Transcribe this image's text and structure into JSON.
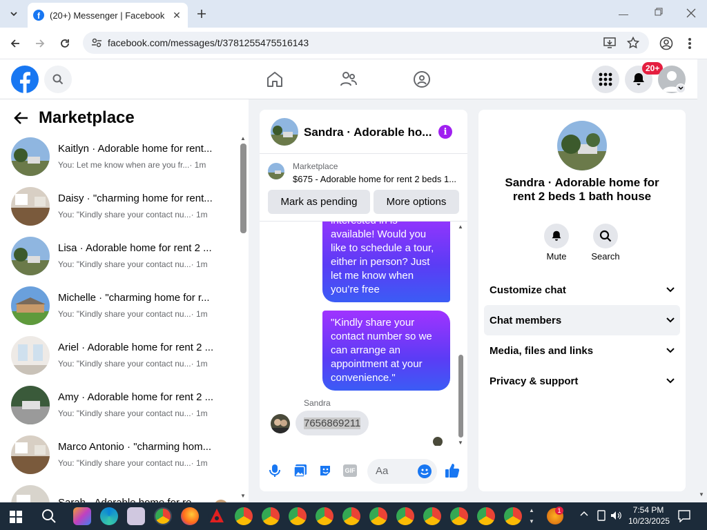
{
  "browser": {
    "tab_title": "(20+) Messenger | Facebook",
    "url": "facebook.com/messages/t/3781255475516143"
  },
  "topbar": {
    "notification_badge": "20+"
  },
  "marketplace": {
    "title": "Marketplace",
    "conversations": [
      {
        "name": "Kaitlyn · Adorable home for rent...",
        "preview": "You: Let me know when are you fr...",
        "time": "· 1m"
      },
      {
        "name": "Daisy · \"charming home for rent...",
        "preview": "You: \"Kindly share your contact nu...",
        "time": "· 1m"
      },
      {
        "name": "Lisa · Adorable home for rent 2 ...",
        "preview": "You: \"Kindly share your contact nu...",
        "time": "· 1m"
      },
      {
        "name": "Michelle · \"charming home for r...",
        "preview": "You: \"Kindly share your contact nu...",
        "time": "· 1m"
      },
      {
        "name": "Ariel · Adorable home for rent 2 ...",
        "preview": "You: \"Kindly share your contact nu...",
        "time": "· 1m"
      },
      {
        "name": "Amy · Adorable home for rent 2 ...",
        "preview": "You: \"Kindly share your contact nu...",
        "time": "· 1m"
      },
      {
        "name": "Marco Antonio · \"charming hom...",
        "preview": "You: \"Kindly share your contact nu...",
        "time": "· 1m"
      },
      {
        "name": "Sarah · Adorable home for re...",
        "preview": "",
        "time": ""
      }
    ]
  },
  "chat": {
    "title": "Sandra · Adorable ho...",
    "listing_label": "Marketplace",
    "listing_desc": "$675 - Adorable home for rent 2 beds 1...",
    "mark_pending": "Mark as pending",
    "more_options": "More options",
    "msg1": "interested in is available! Would you like to schedule a tour, either in person? Just let me know when you’re free",
    "msg2": "\"Kindly share your contact number so we can arrange an appointment at your convenience.\"",
    "sender": "Sandra",
    "reply": "7656869211",
    "input_placeholder": "Aa"
  },
  "info": {
    "name": "Sandra · Adorable home for rent 2 beds 1 bath house",
    "mute": "Mute",
    "search": "Search",
    "rows": [
      "Customize chat",
      "Chat members",
      "Media, files and links",
      "Privacy & support"
    ]
  },
  "taskbar": {
    "time": "7:54 PM",
    "date": "10/23/2025",
    "widget_badge": "1"
  },
  "colors": {
    "fb_blue": "#1877f2",
    "bubble_purple": "#7b3cf5",
    "badge_red": "#e41e3f"
  }
}
